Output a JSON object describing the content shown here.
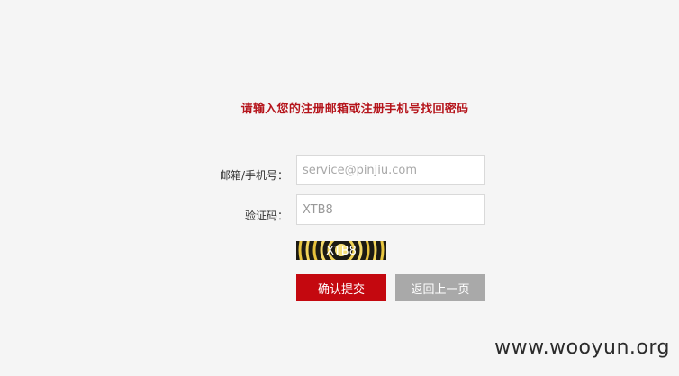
{
  "form": {
    "heading": "请输入您的注册邮箱或注册手机号找回密码",
    "email_label": "邮箱/手机号：",
    "email_placeholder": "service@pinjiu.com",
    "code_label": "验证码：",
    "code_value": "XTB8",
    "captcha_text": "XTB8",
    "submit_label": "确认提交",
    "back_label": "返回上一页"
  },
  "colors": {
    "accent": "#c4080f",
    "heading": "#b5141b",
    "secondary_button": "#a9a9a9",
    "background": "#f5f5f5"
  },
  "watermark": "www.wooyun.org"
}
